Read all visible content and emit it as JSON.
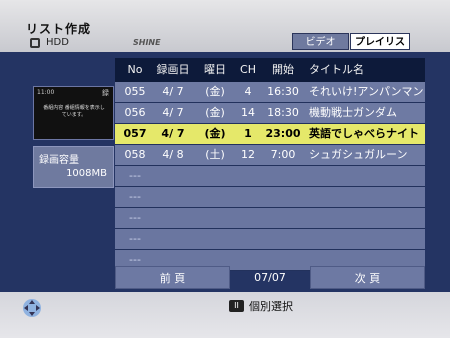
{
  "header": {
    "title": "リスト作成",
    "subtitle": "HDD",
    "logo": "SHINE"
  },
  "tabs": [
    {
      "label": "ビデオ",
      "active": false
    },
    {
      "label": "プレイリスト",
      "active": true
    }
  ],
  "thumbnail": {
    "time": "11:00",
    "icon_label": "録",
    "text": "番組内容 番組情報を表示しています。"
  },
  "capacity": {
    "label": "録画容量",
    "value": "1008MB"
  },
  "table": {
    "headers": {
      "no": "No",
      "date": "録画日",
      "day": "曜日",
      "ch": "CH",
      "start": "開始",
      "title": "タイトル名"
    },
    "rows": [
      {
        "no": "055",
        "date": "4/ 7",
        "day": "(金)",
        "ch": "4",
        "start": "16:30",
        "title": "それいけ!アンパンマン"
      },
      {
        "no": "056",
        "date": "4/ 7",
        "day": "(金)",
        "ch": "14",
        "start": "18:30",
        "title": "機動戦士ガンダム"
      },
      {
        "no": "057",
        "date": "4/ 7",
        "day": "(金)",
        "ch": "1",
        "start": "23:00",
        "title": "英語でしゃべらナイト"
      },
      {
        "no": "058",
        "date": "4/ 8",
        "day": "(土)",
        "ch": "12",
        "start": "7:00",
        "title": "シュガシュガルーン"
      },
      {
        "no": "---"
      },
      {
        "no": "---"
      },
      {
        "no": "---"
      },
      {
        "no": "---"
      },
      {
        "no": "---"
      }
    ]
  },
  "footer": {
    "prev": "前 頁",
    "page": "07/07",
    "next": "次 頁"
  },
  "bottom": {
    "hint": "個別選択",
    "pause_label": "II"
  }
}
